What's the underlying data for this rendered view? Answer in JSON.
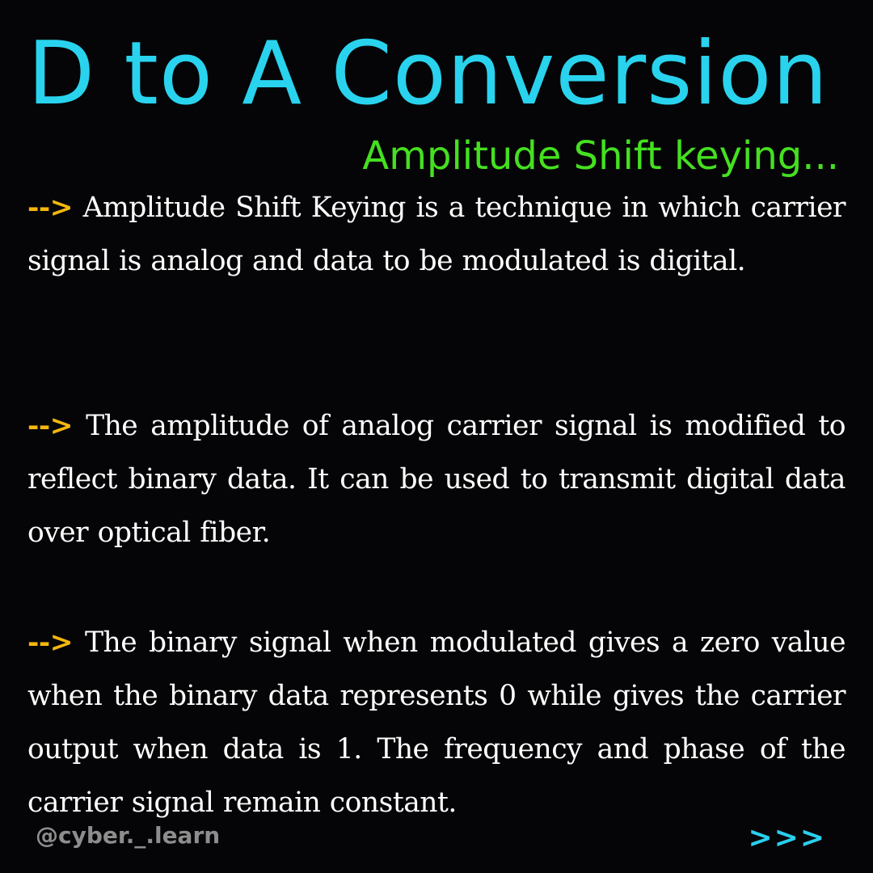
{
  "header": {
    "title": "D to A Conversion",
    "subtitle": "Amplitude Shift keying..."
  },
  "content": {
    "bullet_marker": "-->",
    "paragraphs": [
      {
        "text": "Amplitude Shift Keying is a technique in which carrier signal is analog and data to be modulated is digital."
      },
      {
        "text": "The amplitude of analog carrier signal is modified to reflect binary data. It can be used to transmit digital data over optical fiber."
      },
      {
        "text": "The binary signal when modulated gives a zero value when the binary data represents 0 while gives the carrier output when data is 1. The frequency and phase of the carrier signal remain constant."
      }
    ]
  },
  "footer": {
    "handle": "@cyber._.learn",
    "next_indicator": ">>>"
  },
  "colors": {
    "background": "#050507",
    "title": "#29d3ee",
    "subtitle": "#45e020",
    "bullet_marker": "#f5b70f",
    "body_text": "#ffffff",
    "handle": "#8d8d8d",
    "next_indicator": "#29cfef"
  }
}
